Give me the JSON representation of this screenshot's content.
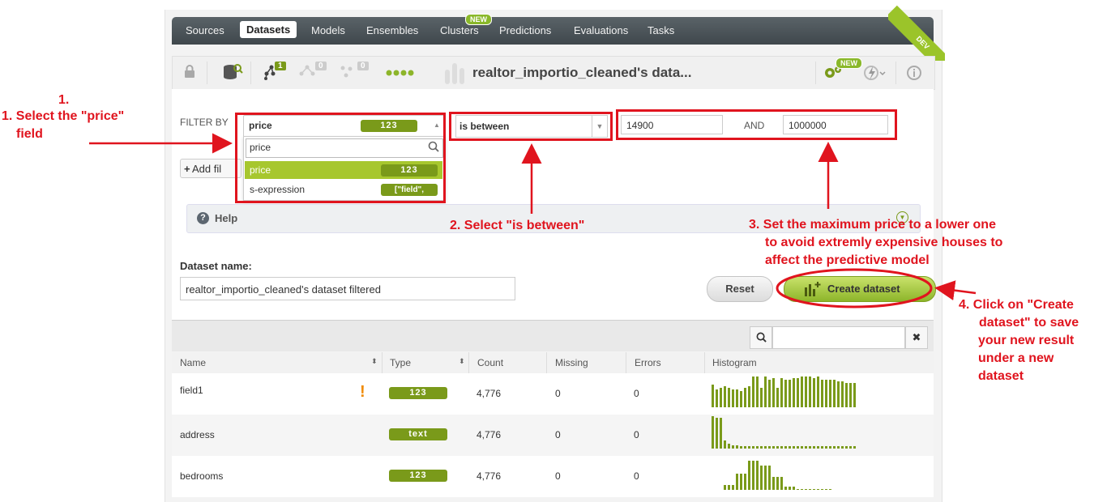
{
  "nav": {
    "items": [
      "Sources",
      "Datasets",
      "Models",
      "Ensembles",
      "Clusters",
      "Predictions",
      "Evaluations",
      "Tasks"
    ],
    "active": "Datasets",
    "new_badge": "NEW",
    "dev_ribbon": "DEV"
  },
  "toolbar": {
    "lock_icon": "lock-icon",
    "datasets_count": "1",
    "models_count": "0",
    "clusters_count": "0",
    "dataset_title": "realtor_importio_cleaned's data...",
    "new_badge": "NEW"
  },
  "filter": {
    "label": "FILTER BY",
    "field_value": "price",
    "field_type": "123",
    "search_value": "price",
    "options": [
      {
        "label": "price",
        "type": "123",
        "selected": true
      },
      {
        "label": "s-expression",
        "type": "[\"field\",",
        "selected": false
      }
    ],
    "operator": "is between",
    "min_value": "14900",
    "and_label": "AND",
    "max_value": "1000000",
    "add_filter_label": "Add fil"
  },
  "help": {
    "label": "Help"
  },
  "dataset_name": {
    "label": "Dataset name:",
    "value": "realtor_importio_cleaned's dataset filtered"
  },
  "buttons": {
    "reset": "Reset",
    "create": "Create dataset"
  },
  "table": {
    "headers": [
      "Name",
      "Type",
      "Count",
      "Missing",
      "Errors",
      "Histogram"
    ],
    "rows": [
      {
        "name": "field1",
        "type": "123",
        "count": "4,776",
        "missing": "0",
        "errors": "0",
        "warning": "!",
        "hist": [
          0.7,
          0.55,
          0.6,
          0.65,
          0.6,
          0.55,
          0.55,
          0.5,
          0.6,
          0.65,
          0.95,
          0.95,
          0.6,
          0.95,
          0.85,
          0.9,
          0.6,
          0.9,
          0.85,
          0.85,
          0.9,
          0.9,
          0.95,
          0.95,
          0.95,
          0.9,
          0.95,
          0.85,
          0.85,
          0.85,
          0.85,
          0.8,
          0.8,
          0.75,
          0.75,
          0.75
        ]
      },
      {
        "name": "address",
        "type": "text",
        "count": "4,776",
        "missing": "0",
        "errors": "0",
        "warning": "",
        "hist": [
          1.0,
          0.95,
          0.95,
          0.25,
          0.15,
          0.1,
          0.1,
          0.08,
          0.08,
          0.08,
          0.08,
          0.08,
          0.08,
          0.08,
          0.08,
          0.08,
          0.08,
          0.08,
          0.08,
          0.08,
          0.08,
          0.08,
          0.08,
          0.08,
          0.08,
          0.08,
          0.08,
          0.08,
          0.08,
          0.08,
          0.08,
          0.08,
          0.08,
          0.08,
          0.08,
          0.08
        ]
      },
      {
        "name": "bedrooms",
        "type": "123",
        "count": "4,776",
        "missing": "0",
        "errors": "0",
        "warning": "",
        "hist": [
          0,
          0,
          0,
          0.15,
          0.15,
          0.15,
          0.5,
          0.5,
          0.5,
          0.9,
          0.9,
          0.9,
          0.75,
          0.75,
          0.75,
          0.4,
          0.4,
          0.4,
          0.1,
          0.1,
          0.1,
          0.03,
          0.03,
          0.03,
          0.03,
          0.03,
          0.03,
          0.02,
          0.02,
          0.02,
          0,
          0,
          0,
          0,
          0,
          0
        ]
      }
    ]
  },
  "annotations": {
    "step1_num": "1.",
    "step1a": "1. Select the \"price\"",
    "step1b": "field",
    "step2": "2. Select \"is between\"",
    "step3a": "3. Set the maximum price to a lower one",
    "step3b": "to avoid extremly expensive houses to",
    "step3c": "affect the predictive model",
    "step4a": "4. Click on \"Create",
    "step4b": "dataset\" to save",
    "step4c": "your new result",
    "step4d": "under a new",
    "step4e": "dataset"
  },
  "colors": {
    "accent_green": "#8db52a",
    "annotation_red": "#e0141e",
    "nav_dark": "#4a5257"
  }
}
